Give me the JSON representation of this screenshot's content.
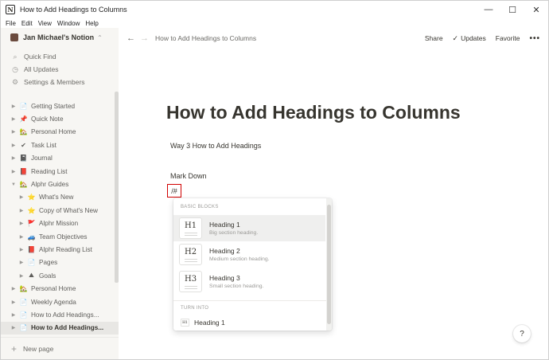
{
  "window": {
    "title": "How to Add Headings to Columns",
    "controls": {
      "minimize": "—",
      "maximize": "☐",
      "close": "✕"
    }
  },
  "menubar": [
    "File",
    "Edit",
    "View",
    "Window",
    "Help"
  ],
  "sidebar": {
    "workspace": "Jan Michael's Notion",
    "top_items": [
      {
        "label": "Quick Find",
        "icon": "search-icon"
      },
      {
        "label": "All Updates",
        "icon": "clock-icon"
      },
      {
        "label": "Settings & Members",
        "icon": "gear-icon"
      }
    ],
    "pages": [
      {
        "label": "Getting Started",
        "icon": "📄",
        "indent": 0
      },
      {
        "label": "Quick Note",
        "icon": "📌",
        "indent": 0
      },
      {
        "label": "Personal Home",
        "icon": "🏡",
        "indent": 0
      },
      {
        "label": "Task List",
        "icon": "✔",
        "indent": 0
      },
      {
        "label": "Journal",
        "icon": "📓",
        "indent": 0
      },
      {
        "label": "Reading List",
        "icon": "📕",
        "indent": 0
      },
      {
        "label": "Alphr Guides",
        "icon": "🏡",
        "indent": 0,
        "expanded": true
      },
      {
        "label": "What's New",
        "icon": "⭐",
        "indent": 1
      },
      {
        "label": "Copy of What's New",
        "icon": "⭐",
        "indent": 1
      },
      {
        "label": "Alphr Mission",
        "icon": "🚩",
        "indent": 1
      },
      {
        "label": "Team Objectives",
        "icon": "🚙",
        "indent": 1
      },
      {
        "label": "Alphr Reading List",
        "icon": "📕",
        "indent": 1
      },
      {
        "label": "Pages",
        "icon": "📄",
        "indent": 1
      },
      {
        "label": "Goals",
        "icon": "⛰",
        "indent": 1
      },
      {
        "label": "Personal Home",
        "icon": "🏡",
        "indent": 0
      },
      {
        "label": "Weekly Agenda",
        "icon": "📄",
        "indent": 0
      },
      {
        "label": "How to Add Headings...",
        "icon": "📄",
        "indent": 0
      },
      {
        "label": "How to Add Headings...",
        "icon": "📄",
        "indent": 0,
        "selected": true
      }
    ],
    "new_page": "New page"
  },
  "topbar": {
    "breadcrumb": "How to Add Headings to Columns",
    "share": "Share",
    "updates": "Updates",
    "favorite": "Favorite",
    "more": "•••"
  },
  "page": {
    "title": "How to Add Headings to Columns",
    "blocks": [
      "Way 3 How to Add Headings",
      "Mark Down"
    ],
    "slash_input": "/#"
  },
  "popup": {
    "section_basic": "BASIC BLOCKS",
    "options": [
      {
        "thumb": "H1",
        "title": "Heading 1",
        "subtitle": "Big section heading."
      },
      {
        "thumb": "H2",
        "title": "Heading 2",
        "subtitle": "Medium section heading."
      },
      {
        "thumb": "H3",
        "title": "Heading 3",
        "subtitle": "Small section heading."
      }
    ],
    "section_turn": "TURN INTO",
    "turn_option": {
      "thumb": "H1",
      "title": "Heading 1"
    }
  },
  "help": "?"
}
